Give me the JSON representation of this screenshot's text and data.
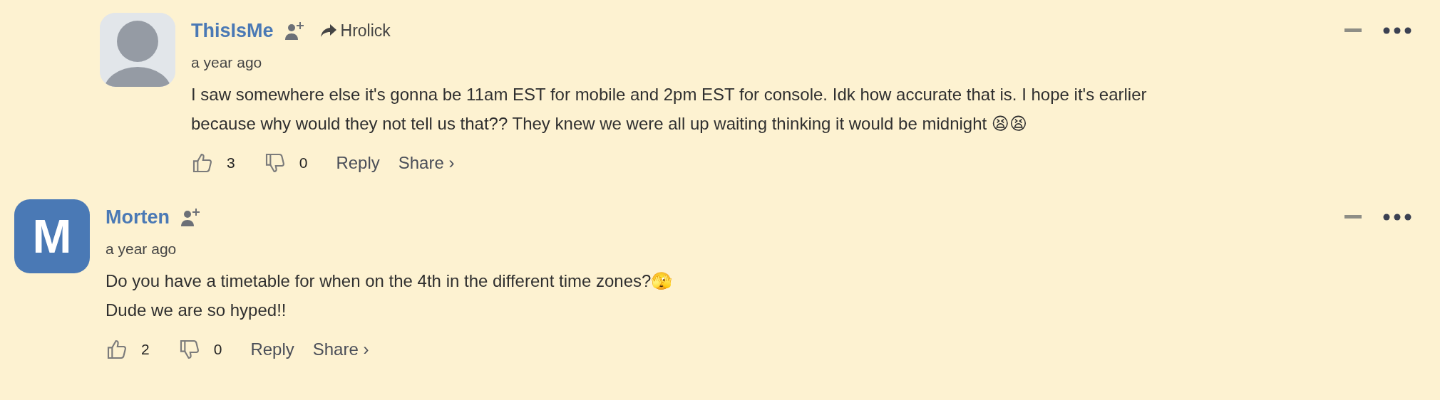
{
  "comments": [
    {
      "kind": "reply",
      "author": "ThisIsMe",
      "avatar": {
        "kind": "silhouette"
      },
      "reply_to": "Hrolick",
      "time": "a year ago",
      "body": [
        "I saw somewhere else it's gonna be 11am EST for mobile and 2pm EST for console. Idk how accurate that is. I hope it's earlier",
        "because why would they not tell us that?? They knew we were all up waiting thinking it would be midnight 😫😫"
      ],
      "likes": "3",
      "dislikes": "0",
      "reply": "Reply",
      "share": "Share ›"
    },
    {
      "kind": "top",
      "author": "Morten",
      "avatar": {
        "kind": "letter",
        "letter": "M",
        "color": "#4a79b5"
      },
      "time": "a year ago",
      "body": [
        "Do you have a timetable for when on the 4th in the different time zones?🫣",
        "Dude we are so hyped!!"
      ],
      "likes": "2",
      "dislikes": "0",
      "reply": "Reply",
      "share": "Share ›"
    }
  ]
}
